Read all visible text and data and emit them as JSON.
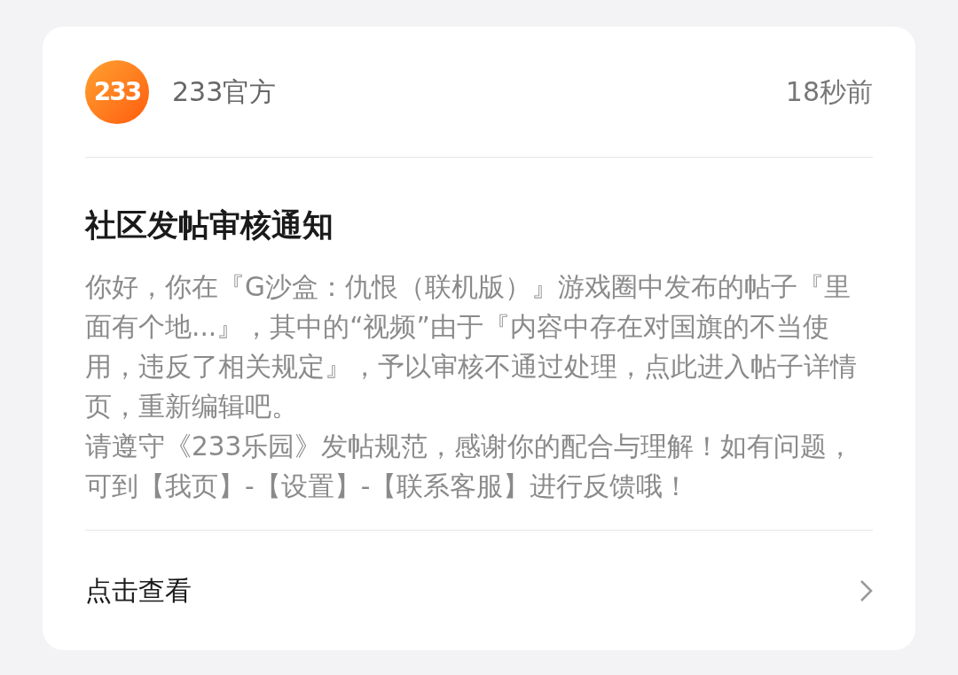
{
  "notification": {
    "sender": {
      "logo_text": "233",
      "name": "233官方"
    },
    "time": "18秒前",
    "title": "社区发帖审核通知",
    "body": [
      "你好，你在『G沙盒：仇恨（联机版）』游戏圈中发布的帖子『里面有个地...』，其中的“视频”由于『内容中存在对国旗的不当使用，违反了相关规定』，予以审核不通过处理，点此进入帖子详情页，重新编辑吧。",
      "请遵守《233乐园》发帖规范，感谢你的配合与理解！如有问题，可到【我页】-【设置】-【联系客服】进行反馈哦！"
    ],
    "action": {
      "label": "点击查看"
    }
  }
}
